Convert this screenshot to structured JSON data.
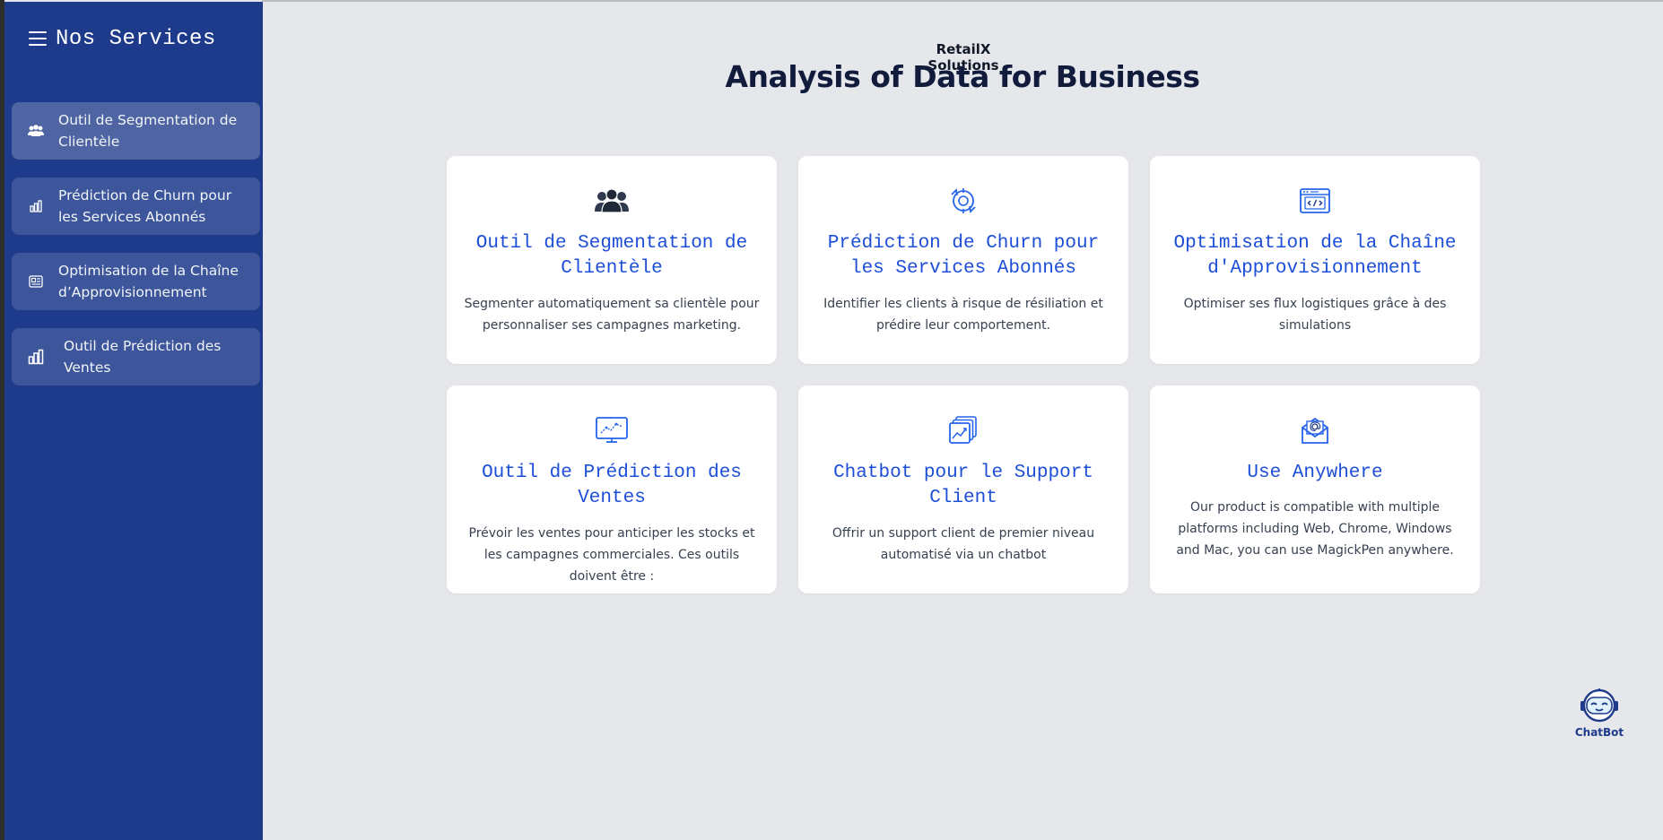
{
  "sidebar": {
    "title": "Nos Services",
    "menu_icon": "hamburger-menu-icon",
    "items": [
      {
        "label": "Outil de Segmentation de Clientèle",
        "icon": "users-icon"
      },
      {
        "label": "Prédiction de Churn pour les Services Abonnés",
        "icon": "bar-chart-icon"
      },
      {
        "label": "Optimisation de la Chaîne d’Approvisionnement",
        "icon": "newspaper-icon"
      },
      {
        "label": "Outil de Prédiction des Ventes",
        "icon": "bar-chart-icon"
      }
    ]
  },
  "header": {
    "subtitle": "RetailX Solutions",
    "title": "Analysis of Data for Business"
  },
  "cards": [
    {
      "title": "Outil de Segmentation de Clientèle",
      "description": "Segmenter automatiquement sa clientèle pour personnaliser ses campagnes marketing.",
      "icon": "users-group-icon"
    },
    {
      "title": "Prédiction de Churn pour les Services Abonnés",
      "description": "Identifier les clients à risque de résiliation et prédire leur comportement.",
      "icon": "cycle-refresh-icon"
    },
    {
      "title": "Optimisation de la Chaîne d'Approvisionnement",
      "description": "Optimiser ses flux logistiques grâce à des simulations",
      "icon": "code-window-icon"
    },
    {
      "title": "Outil de Prédiction des Ventes",
      "description": "Prévoir les ventes pour anticiper les stocks et les campagnes commerciales. Ces outils doivent être :",
      "icon": "monitor-chart-icon"
    },
    {
      "title": "Chatbot pour le Support Client",
      "description": "Offrir un support client de premier niveau automatisé via un chatbot",
      "icon": "stacked-chart-icon"
    },
    {
      "title": "Use Anywhere",
      "description": "Our product is compatible with multiple platforms including Web, Chrome, Windows and Mac, you can use MagickPen anywhere.",
      "icon": "email-open-icon"
    }
  ],
  "chatbot": {
    "label": "ChatBot",
    "icon": "robot-icon"
  },
  "colors": {
    "sidebar_bg": "#1e3a8a",
    "page_bg": "#e5e7eb",
    "card_title": "#1d4ed8",
    "icon_blue": "#2563eb"
  }
}
